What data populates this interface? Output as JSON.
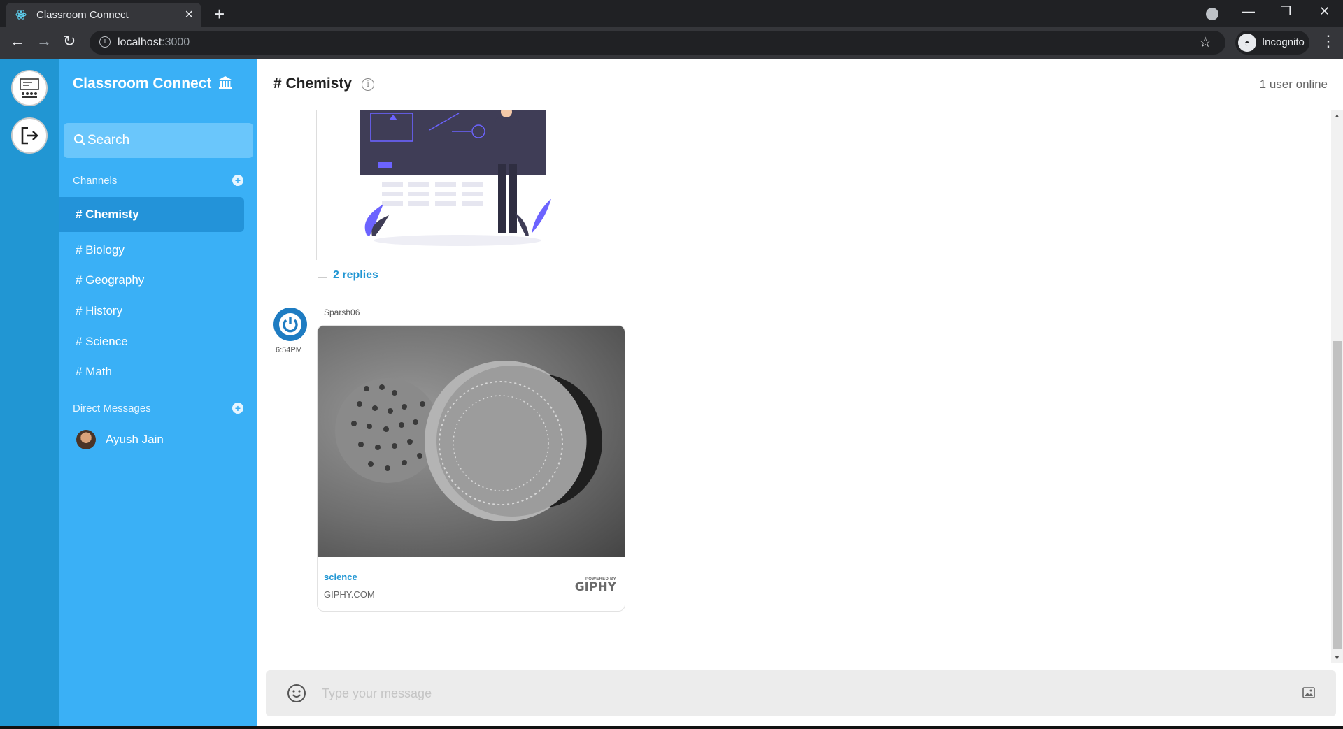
{
  "browser": {
    "tab_title": "Classroom Connect",
    "tab_close": "×",
    "new_tab": "+",
    "url_host": "localhost",
    "url_port": ":3000",
    "profile_label": "Incognito",
    "window_controls": [
      "—",
      "❐",
      "✕"
    ]
  },
  "sidebar": {
    "brand": "Classroom Connect",
    "search_placeholder": "Search",
    "channels_title": "Channels",
    "channels": [
      {
        "label": "# Chemisty",
        "active": true
      },
      {
        "label": "# Biology",
        "active": false
      },
      {
        "label": "# Geography",
        "active": false
      },
      {
        "label": "# History",
        "active": false
      },
      {
        "label": "# Science",
        "active": false
      },
      {
        "label": "# Math",
        "active": false
      }
    ],
    "dm_title": "Direct Messages",
    "direct_messages": [
      {
        "name": "Ayush Jain"
      }
    ]
  },
  "header": {
    "channel_title": "# Chemisty",
    "info_glyph": "i",
    "online_status": "1 user online"
  },
  "feed": {
    "replies_label": "2 replies",
    "message": {
      "user": "Sparsh06",
      "time": "6:54PM",
      "gif": {
        "title": "science",
        "site": "GIPHY.COM",
        "powered_by": "POWERED BY",
        "brand": "GIPHY"
      }
    }
  },
  "composer": {
    "placeholder": "Type your message"
  },
  "colors": {
    "rail": "#2196d3",
    "sidebar": "#3ab0f6",
    "active_channel": "#2393d9",
    "link": "#2196d3"
  },
  "icons": [
    "react-logo-icon",
    "classroom-icon",
    "logout-icon",
    "search-icon",
    "add-channel-icon",
    "add-dm-icon",
    "info-icon",
    "emoji-icon",
    "image-upload-icon",
    "bank-icon"
  ]
}
